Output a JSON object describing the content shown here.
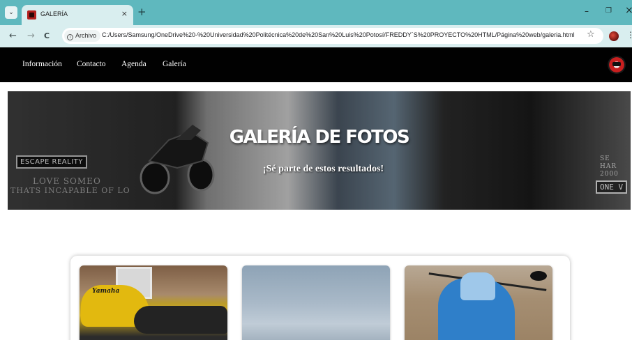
{
  "browser": {
    "tab": {
      "title": "GALERÍA",
      "close_glyph": "×",
      "favicon": "site-favicon"
    },
    "tab_menu_glyph": "⌄",
    "new_tab_glyph": "+",
    "window_controls": {
      "minimize": "–",
      "restore": "❐",
      "close": "×"
    },
    "toolbar": {
      "back_glyph": "←",
      "forward_glyph": "→",
      "reload_glyph": "C",
      "security_chip": "Archivo",
      "url": "C:/Users/Samsung/OneDrive%20-%20Universidad%20Politécnica%20de%20San%20Luis%20Potosí/FREDDY´S%20PROYECTO%20HTML/Página%20web/galeria.html",
      "bookmark_glyph": "☆",
      "menu_glyph": "⋮"
    }
  },
  "site": {
    "nav": [
      "Información",
      "Contacto",
      "Agenda",
      "Galería"
    ],
    "hero": {
      "title": "GALERÍA DE FOTOS",
      "subtitle": "¡Sé parte de estos resultados!",
      "background_signs": {
        "escape": "ESCAPE REALITY",
        "graffiti_1": "LOVE SOMEO",
        "graffiti_2": "THATS INCAPABLE OF LO",
        "right_sign": "ONE V",
        "right_small": "SE HAR 2000"
      }
    },
    "gallery": {
      "photo_1_brand": "Yamaha"
    }
  },
  "colors": {
    "tabstrip": "#5fb8be",
    "toolbar": "#d9eeef",
    "site_nav": "#010101",
    "text_on_dark": "#ffffff"
  }
}
